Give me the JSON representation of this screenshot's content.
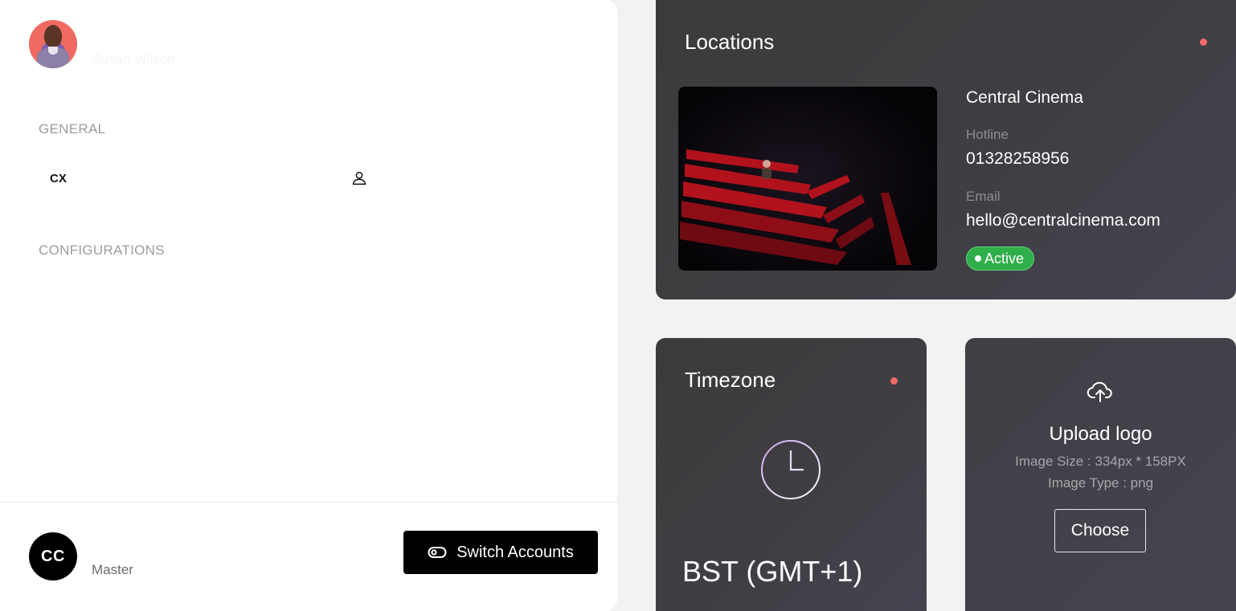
{
  "user": {
    "name": "Susan Wilson"
  },
  "sidebar": {
    "general_label": "GENERAL",
    "items": [
      {
        "label": "CX",
        "icon": "user-icon"
      }
    ],
    "configurations_label": "CONFIGURATIONS"
  },
  "account": {
    "initials": "CC",
    "role": "Master",
    "switch_label": "Switch Accounts"
  },
  "locations": {
    "title": "Locations",
    "name": "Central Cinema",
    "hotline_label": "Hotline",
    "hotline": "01328258956",
    "email_label": "Email",
    "email": "hello@centralcinema.com",
    "status": "Active"
  },
  "timezone": {
    "title": "Timezone",
    "value": "BST (GMT+1)"
  },
  "upload": {
    "title": "Upload logo",
    "size_text": "Image Size  : 334px * 158PX",
    "type_text": "Image Type : png",
    "button_label": "Choose"
  },
  "colors": {
    "card_bg": "#3d3c40",
    "status_dot": "#f26a6a",
    "active_badge": "#2fae4a",
    "clock_accent": "#c9a6f2"
  }
}
